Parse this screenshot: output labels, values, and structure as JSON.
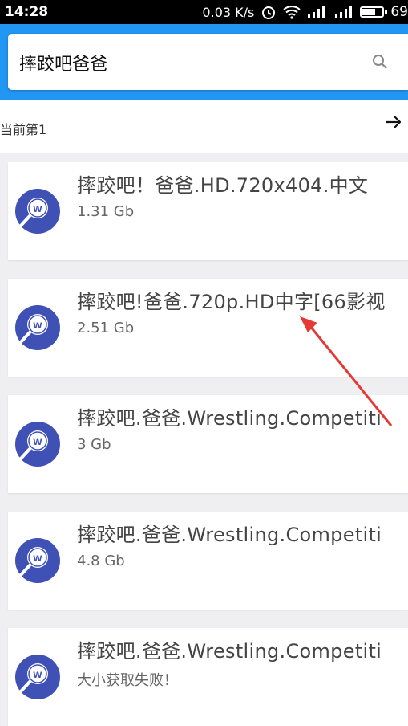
{
  "status_bar": {
    "time": "14:28",
    "net_speed": "0.03 K/s",
    "network": "4G",
    "battery": "69"
  },
  "search": {
    "query": "摔跤吧爸爸"
  },
  "pagination": {
    "label": "当前第1"
  },
  "results": [
    {
      "title": "摔跤吧！爸爸.HD.720x404.中文",
      "size": "1.31 Gb"
    },
    {
      "title": "摔跤吧!爸爸.720p.HD中字[66影视",
      "size": "2.51 Gb"
    },
    {
      "title": "摔跤吧.爸爸.Wrestling.Competiti",
      "size": "3 Gb"
    },
    {
      "title": "摔跤吧.爸爸.Wrestling.Competiti",
      "size": "4.8 Gb"
    },
    {
      "title": "摔跤吧.爸爸.Wrestling.Competiti",
      "size": "大小获取失败！"
    }
  ],
  "colors": {
    "header": "#2196f3",
    "logo_ring": "#3f51b5",
    "annotation": "#e53935"
  },
  "icons": [
    "search-icon",
    "arrow-right-icon",
    "logo-w-icon",
    "alarm-icon",
    "wifi-icon",
    "signal-icon",
    "battery-icon"
  ]
}
